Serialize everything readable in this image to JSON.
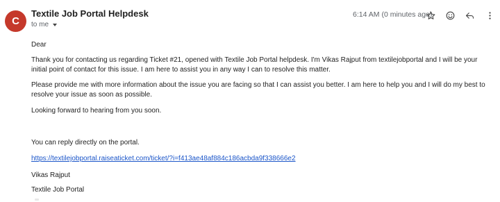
{
  "email": {
    "avatar_letter": "C",
    "sender": "Textile Job Portal Helpdesk",
    "recipient": "to me",
    "timestamp": "6:14 AM (0 minutes ago)"
  },
  "actions": {
    "star_icon": "star-icon",
    "emoji_icon": "emoji-icon",
    "reply_icon": "reply-icon",
    "more_icon": "more-vert-icon"
  },
  "body": {
    "greeting": "Dear ",
    "paragraph1": "Thank you for contacting us regarding Ticket #21, opened with Textile Job Portal helpdesk. I'm Vikas Rajput from textilejobportal and I will be your initial point of contact for this issue. I am here to assist you in any way I can to resolve this matter.",
    "paragraph2": "Please provide me with more information about the issue you are facing so that I can assist you better. I am here to help you and I will do my best to resolve your issue as soon as possible.",
    "paragraph3": "Looking forward to hearing from you soon.",
    "reply_note": "You can reply directly on the portal.",
    "ticket_link": "https://textilejobportal.raiseaticket.com/ticket/?i=f413ae48af884c186acbda9f338666e2",
    "signature_name": "Vikas Rajput",
    "signature_company": "Textile Job Portal"
  },
  "colors": {
    "avatar": "#c5392b",
    "link": "#1a55c9"
  }
}
